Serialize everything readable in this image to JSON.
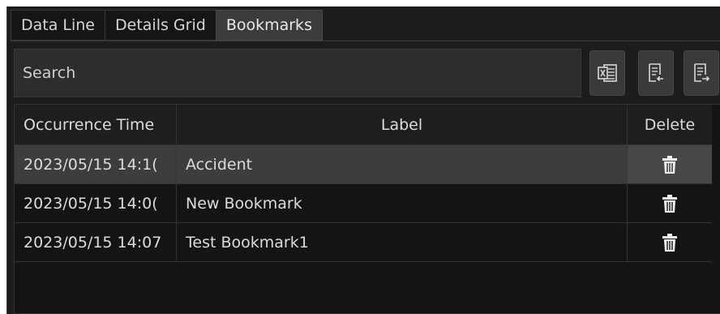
{
  "tabs": [
    {
      "label": "Data Line"
    },
    {
      "label": "Details Grid"
    },
    {
      "label": "Bookmarks"
    }
  ],
  "active_tab": "Bookmarks",
  "search": {
    "placeholder": "Search",
    "value": ""
  },
  "toolbar": {
    "export_excel_icon": "excel-export-icon",
    "import_icon": "document-import-icon",
    "export_icon": "document-export-icon"
  },
  "grid": {
    "columns": [
      "Occurrence Time",
      "Label",
      "Delete"
    ],
    "rows": [
      {
        "time": "2023/05/15 14:1(",
        "label": "Accident",
        "selected": true
      },
      {
        "time": "2023/05/15 14:0(",
        "label": "New Bookmark",
        "selected": false
      },
      {
        "time": "2023/05/15 14:07",
        "label": "Test Bookmark1",
        "selected": false
      }
    ]
  },
  "colors": {
    "background": "#1c1c1c",
    "selected_row": "#3d3d3d",
    "active_tab": "#3c3c3c",
    "text": "#dcdcdc"
  }
}
